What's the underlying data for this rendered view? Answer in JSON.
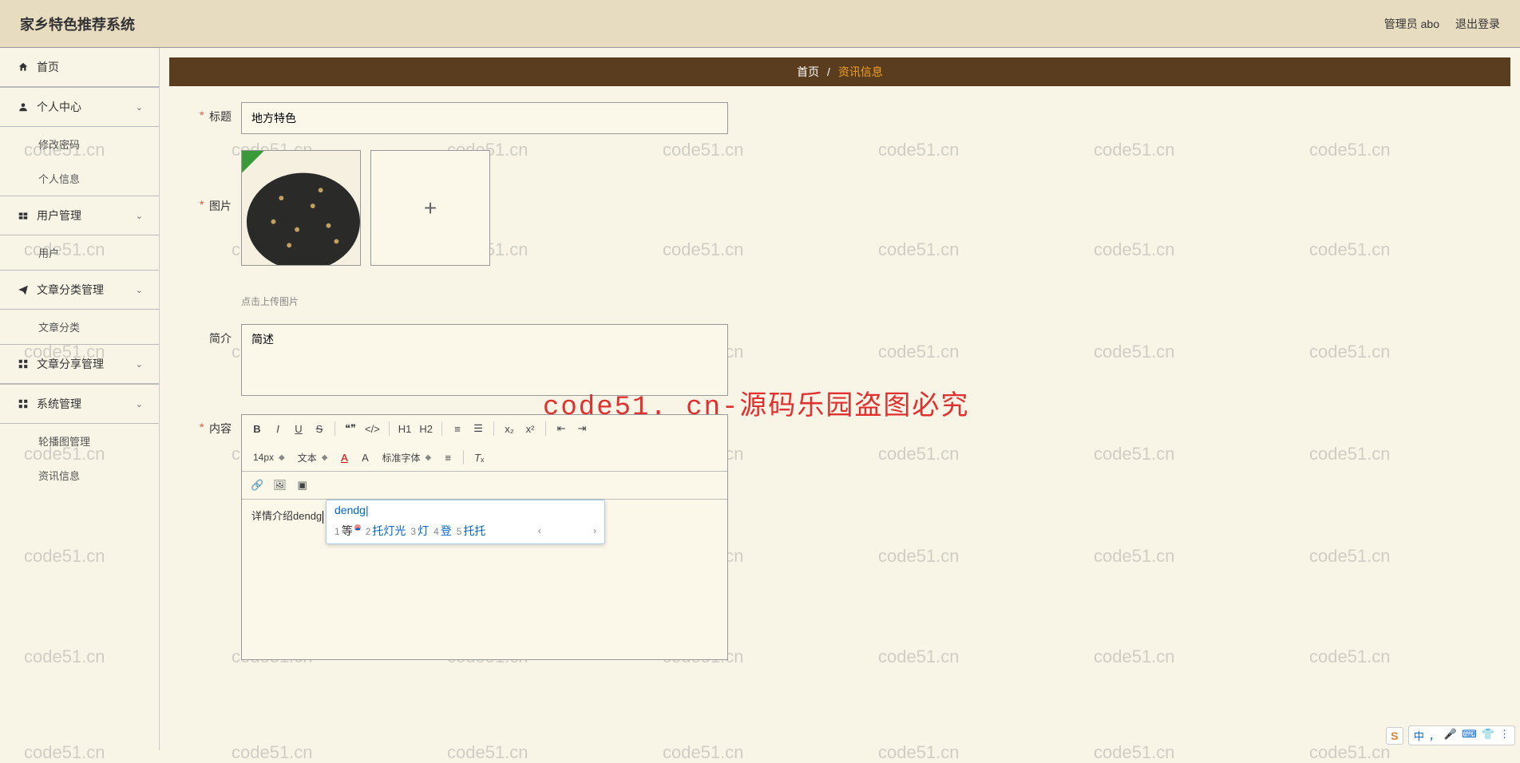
{
  "watermark_text": "code51.cn",
  "red_watermark": "code51. cn-源码乐园盗图必究",
  "topbar": {
    "title": "家乡特色推荐系统",
    "admin_label": "管理员 abo",
    "logout_label": "退出登录"
  },
  "sidebar": {
    "home": "首页",
    "personal_center": "个人中心",
    "change_password": "修改密码",
    "personal_info": "个人信息",
    "user_manage": "用户管理",
    "user": "用户",
    "article_cat_manage": "文章分类管理",
    "article_cat": "文章分类",
    "article_share_manage": "文章分享管理",
    "system_manage": "系统管理",
    "carousel_manage": "轮播图管理",
    "news_info": "资讯信息"
  },
  "breadcrumb": {
    "home": "首页",
    "sep": "/",
    "current": "资讯信息"
  },
  "form": {
    "title_label": "标题",
    "title_value": "地方特色",
    "image_label": "图片",
    "upload_hint": "点击上传图片",
    "intro_label": "简介",
    "intro_value": "简述",
    "content_label": "内容",
    "content_text": "详情介绍dendg"
  },
  "editor_toolbar": {
    "font_size": "14px",
    "font_type": "文本",
    "font_family": "标准字体",
    "h1": "H1",
    "h2": "H2"
  },
  "ime": {
    "input": "dendg",
    "candidates": [
      {
        "num": "1",
        "text": "等"
      },
      {
        "num": "2",
        "text": "托灯光"
      },
      {
        "num": "3",
        "text": "灯"
      },
      {
        "num": "4",
        "text": "登"
      },
      {
        "num": "5",
        "text": "托托"
      }
    ]
  },
  "ime_badge": {
    "logo": "S",
    "lang": "中"
  }
}
